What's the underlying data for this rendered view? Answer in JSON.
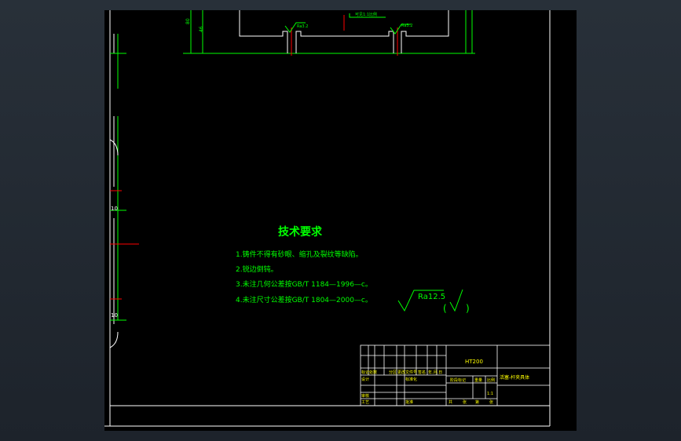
{
  "colors": {
    "background": "#000000",
    "frame": "#ffffff",
    "annotation": "#00ff00",
    "centerline": "#ff0000",
    "title_block_text": "#ffff00"
  },
  "top_dims": {
    "dim_a": "80",
    "dim_b": "46",
    "roughness_left": "Ra3.2",
    "roughness_right": "Ra3.2",
    "centre_note": "可见1:1比例"
  },
  "side_dims": {
    "upper": "10",
    "lower": "10"
  },
  "tech": {
    "title": "技术要求",
    "items": [
      "1.铸件不得有砂眼、缩孔及裂纹等缺陷。",
      "2.锐边倒钝。",
      "3.未注几何公差按GB/T 1184—1996—c。",
      "4.未注尺寸公差按GB/T 1804—2000—c。"
    ]
  },
  "roughness": {
    "value": "Ra12.5",
    "open": "(",
    "close": ")"
  },
  "title_block": {
    "material": "HT200",
    "drawing_name": "活塞-杆夹具体",
    "mark_label": "标记",
    "count_label": "处数",
    "zone_label": "分区",
    "change_doc_label": "更改文件号",
    "sign_label": "签名",
    "date_label": "年.月.日",
    "design_label": "设计",
    "standard_label": "标准化",
    "check_label": "审核",
    "process_label": "工艺",
    "approve_label": "批准",
    "stage_label": "阶段标记",
    "weight_label": "重量",
    "scale_label": "比例",
    "scale_value": "1:1",
    "sheets_label": "共",
    "sheet_label": "张",
    "of_label": "第",
    "sheet2_label": "张"
  }
}
